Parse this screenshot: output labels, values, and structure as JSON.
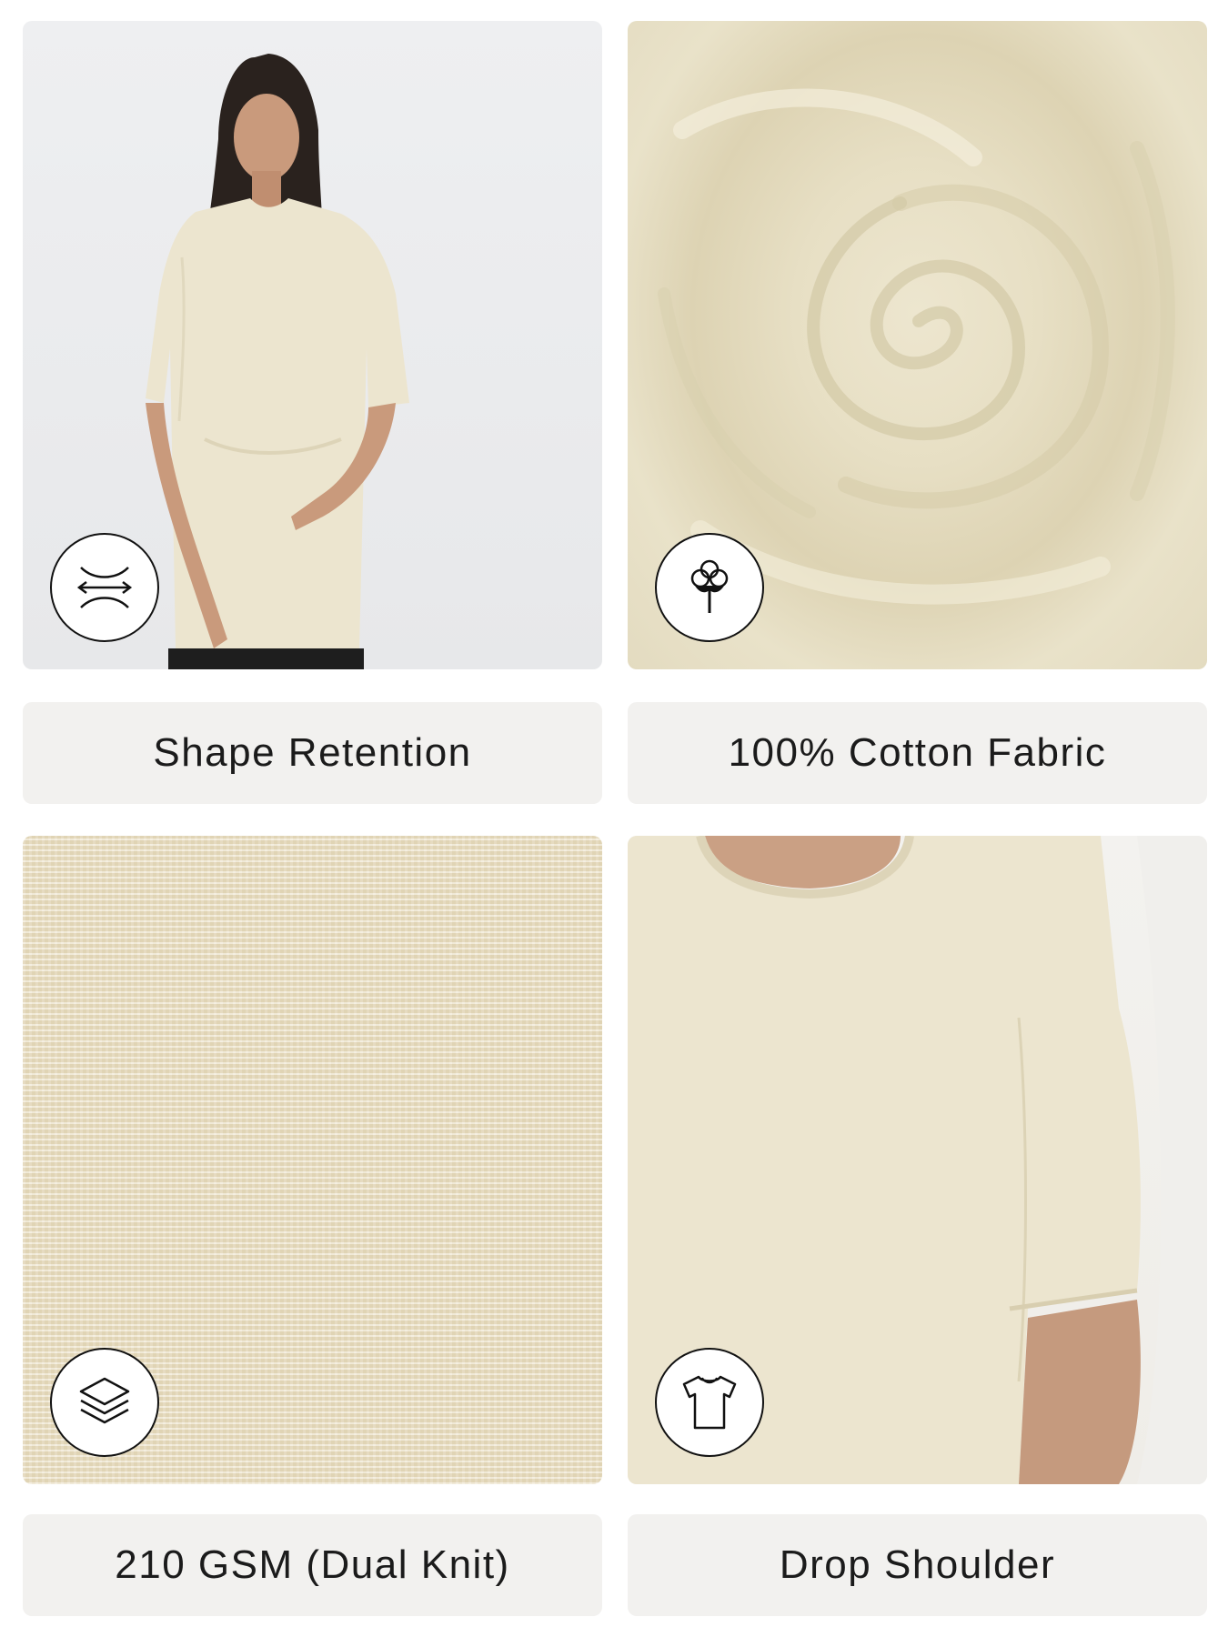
{
  "features": [
    {
      "label": "Shape Retention",
      "icon": "stretch-arrows-icon"
    },
    {
      "label": "100% Cotton Fabric",
      "icon": "cotton-flower-icon"
    },
    {
      "label": "210 GSM (Dual Knit)",
      "icon": "layers-icon"
    },
    {
      "label": "Drop Shoulder",
      "icon": "tshirt-icon"
    }
  ],
  "colors": {
    "fabric": "#ece4cb",
    "label_bg": "#f2f1ef",
    "text": "#1b1b1b"
  }
}
